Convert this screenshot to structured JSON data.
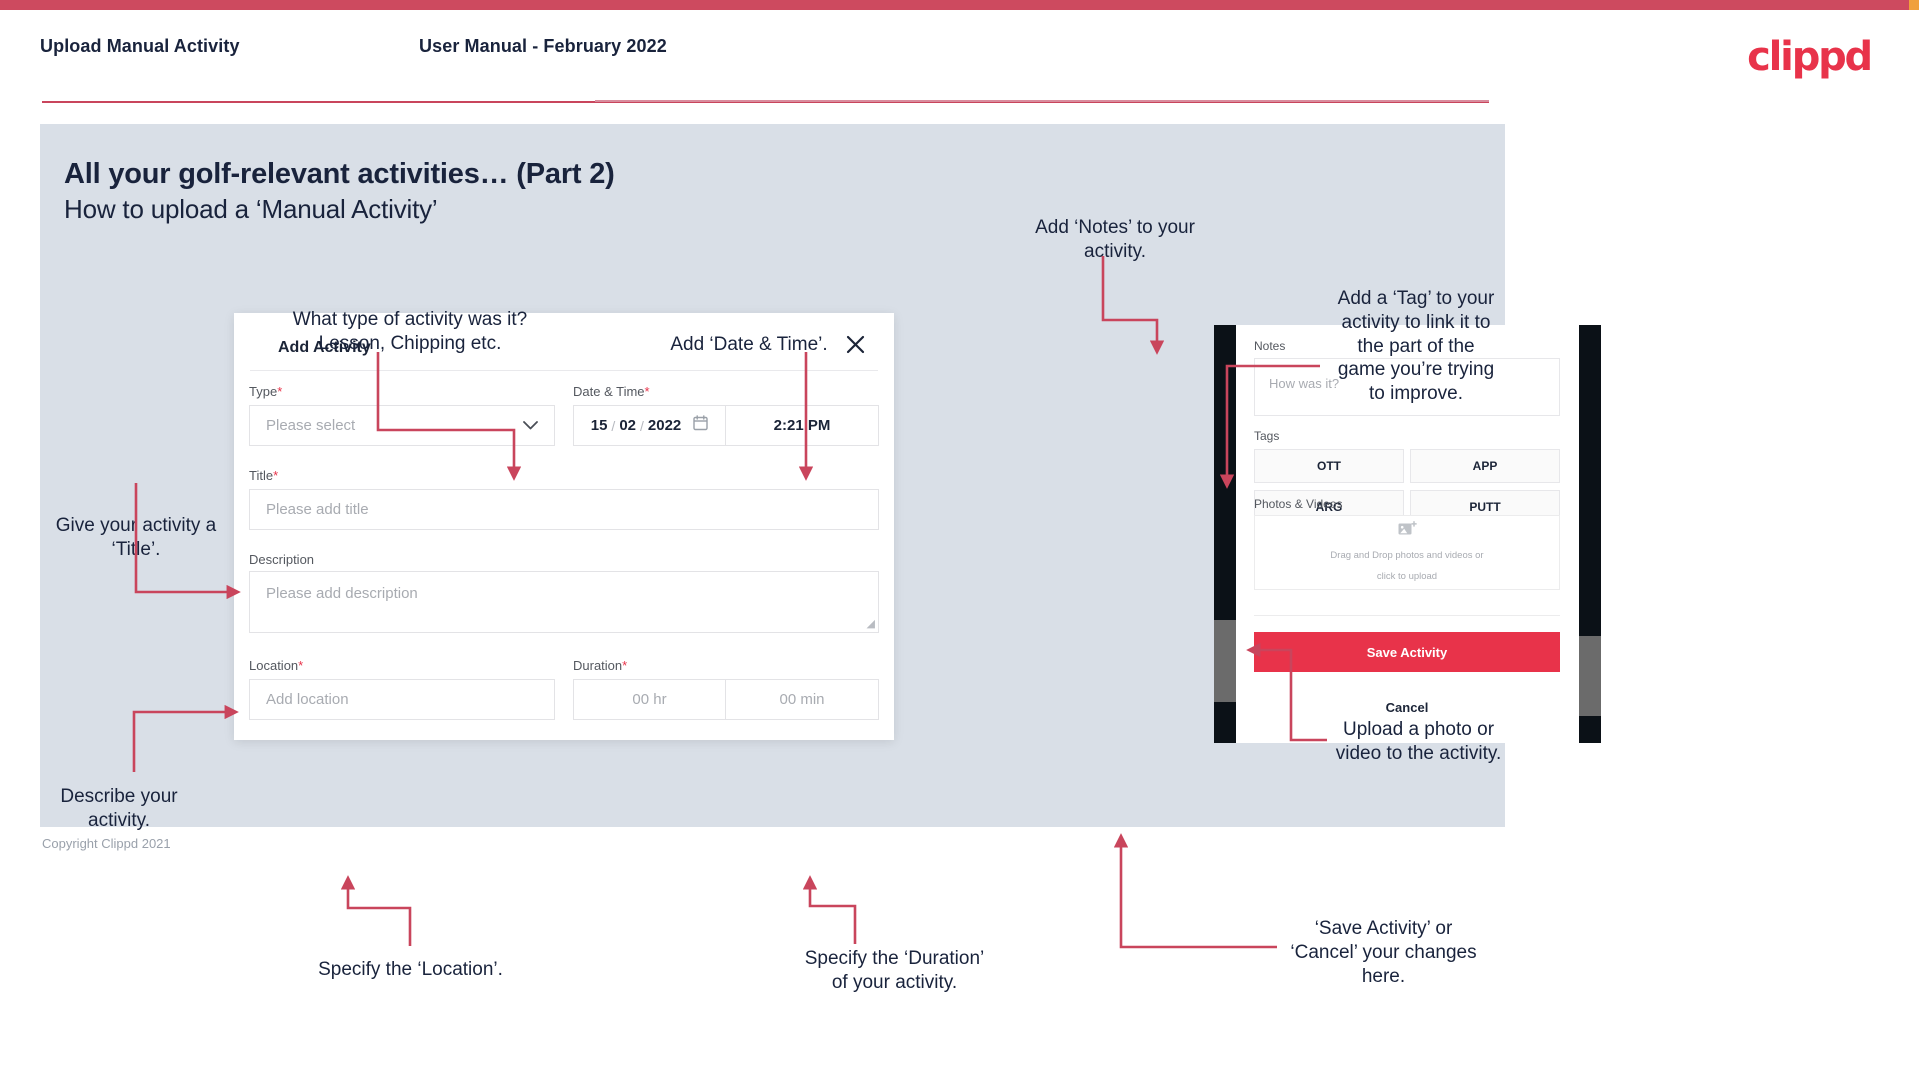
{
  "header": {
    "left_title": "Upload Manual Activity",
    "center_title": "User Manual - February 2022",
    "logo": "clippd"
  },
  "slide": {
    "heading": "All your golf-relevant activities… (Part 2)",
    "subheading": "How to upload a ‘Manual Activity’"
  },
  "footer": {
    "copyright": "Copyright Clippd 2021"
  },
  "dialog": {
    "title": "Add Activity",
    "close_icon": "close-icon",
    "fields": {
      "type": {
        "label": "Type",
        "required": "*",
        "placeholder": "Please select",
        "chevron": "chevron-down-icon"
      },
      "datetime": {
        "label": "Date & Time",
        "required": "*",
        "day": "15",
        "month": "02",
        "year": "2022",
        "sep": "/",
        "calendar_icon": "calendar-icon",
        "time": "2:21 PM"
      },
      "title": {
        "label": "Title",
        "required": "*",
        "placeholder": "Please add title"
      },
      "description": {
        "label": "Description",
        "placeholder": "Please add description"
      },
      "location": {
        "label": "Location",
        "required": "*",
        "placeholder": "Add location"
      },
      "duration": {
        "label": "Duration",
        "required": "*",
        "hours_placeholder": "00 hr",
        "minutes_placeholder": "00 min"
      }
    }
  },
  "phone": {
    "notes": {
      "label": "Notes",
      "placeholder": "How was it?"
    },
    "tags": {
      "label": "Tags",
      "items": [
        "OTT",
        "APP",
        "ARG",
        "PUTT"
      ]
    },
    "photos": {
      "label": "Photos & Videos",
      "icon": "add-image-icon",
      "dropzone_line1": "Drag and Drop photos and videos or",
      "dropzone_line2": "click to upload"
    },
    "save_label": "Save Activity",
    "cancel_label": "Cancel"
  },
  "annotations": {
    "type": "What type of activity was it?\nLesson, Chipping etc.",
    "datetime": "Add ‘Date & Time’.",
    "title": "Give your activity a\n‘Title’.",
    "description": "Describe your\nactivity.",
    "location": "Specify the ‘Location’.",
    "duration": "Specify the ‘Duration’\nof your activity.",
    "notes": "Add ‘Notes’ to your\nactivity.",
    "tags": "Add a ‘Tag’ to your\nactivity to link it to\nthe part of the\ngame you’re trying\nto improve.",
    "photos": "Upload a photo or\nvideo to the activity.",
    "save": "‘Save Activity’ or\n‘Cancel’ your changes\nhere."
  },
  "colors": {
    "brand_pink": "#e8334a",
    "top_bar": "#cd4a5f",
    "slide_bg": "#d9dfe7",
    "ink": "#19233c",
    "arrow": "#c9455c"
  }
}
